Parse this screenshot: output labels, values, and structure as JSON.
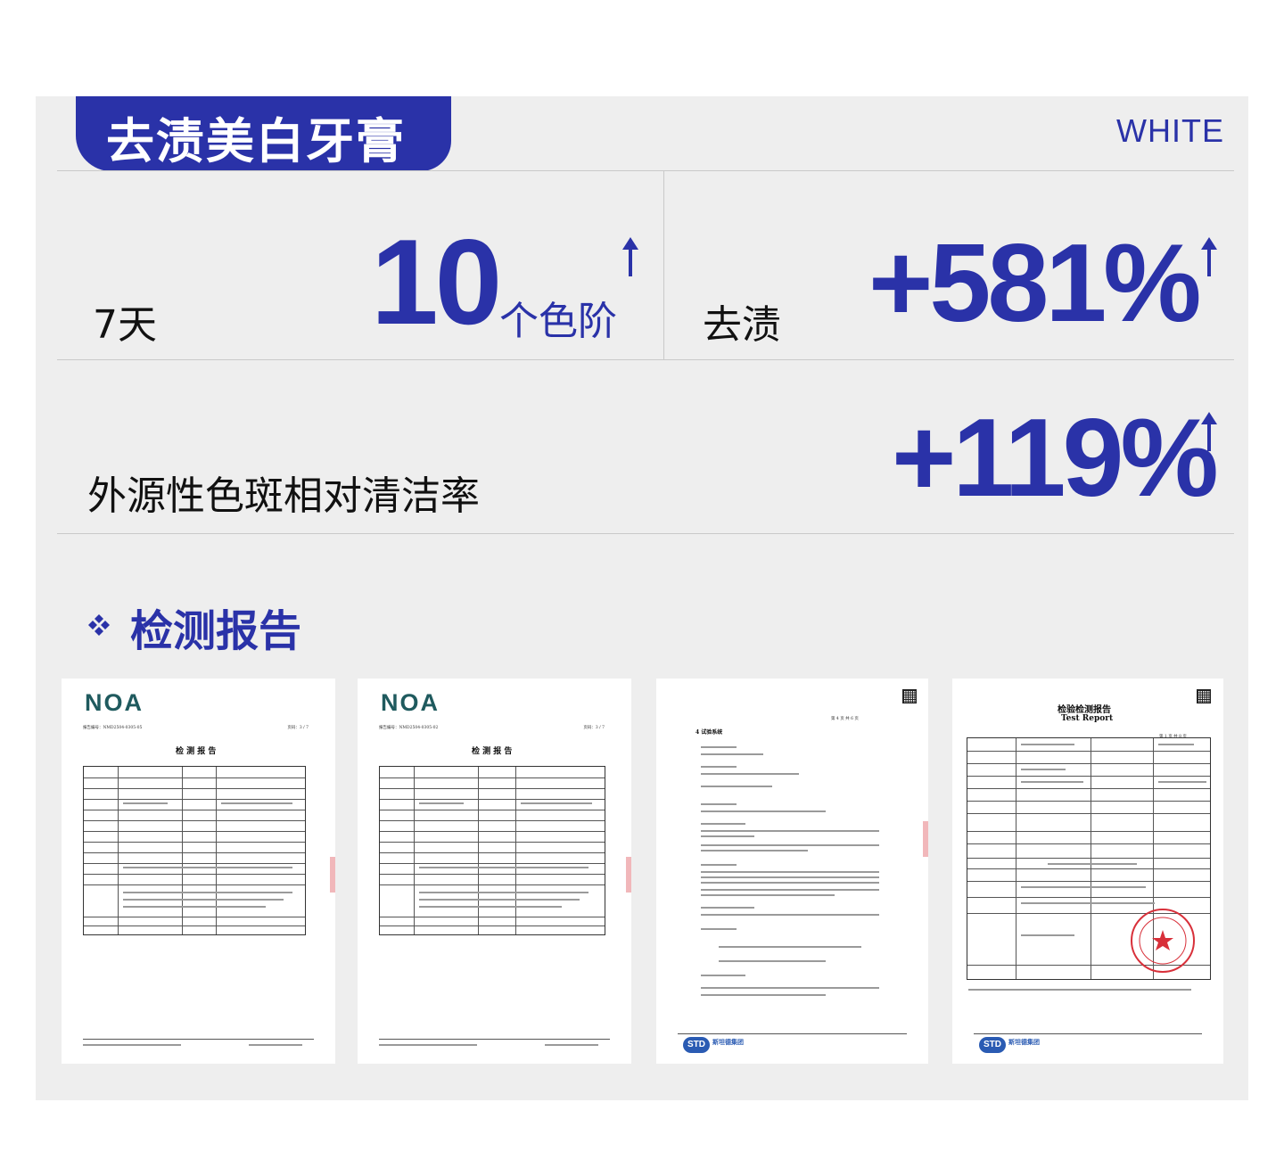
{
  "header": {
    "title": "去渍美白牙膏",
    "brand_word": "WHITE"
  },
  "stats": [
    {
      "label": "7天",
      "value": "10",
      "unit": "个色阶"
    },
    {
      "label": "去渍",
      "value": "+581%",
      "unit": ""
    },
    {
      "label": "外源性色斑相对清洁率",
      "value": "+119%",
      "unit": ""
    }
  ],
  "reports_section": {
    "title": "检测报告",
    "reports": [
      {
        "logo": "NOA",
        "heading": "检 测 报 告",
        "page": "页码：3 / 7"
      },
      {
        "logo": "NOA",
        "heading": "检 测 报 告",
        "page": "页码：3 / 7"
      },
      {
        "logo": "",
        "heading": "4  试验系统",
        "page": "第 4 页 共 6 页",
        "org": "斯坦德集团"
      },
      {
        "logo": "",
        "heading": "检验检测报告",
        "subheading": "Test Report",
        "page": "第 1 页 共 8 页",
        "org": "斯坦德集团"
      }
    ]
  },
  "colors": {
    "accent": "#2a32a8",
    "panel": "#eeeeee",
    "seal_red": "#d8303a"
  },
  "icons": [
    "up-arrow-icon",
    "diamond-cluster-icon",
    "qr-code-icon",
    "red-seal-icon"
  ]
}
